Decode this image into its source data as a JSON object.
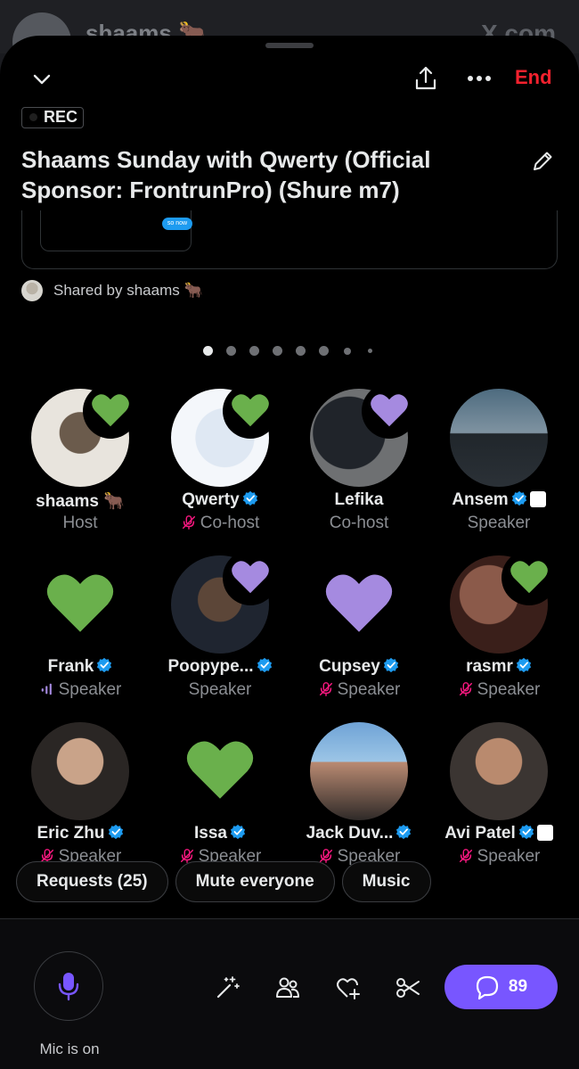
{
  "background": {
    "host_name": "shaams 🐂",
    "domain": "X.com"
  },
  "header": {
    "end_label": "End",
    "rec_label": "REC"
  },
  "space": {
    "title": "Shaams Sunday with Qwerty (Official Sponsor: FrontrunPro) (Shure m7)",
    "card_pill_text": "so now",
    "shared_by": "Shared by shaams 🐂"
  },
  "pager": {
    "total": 8,
    "active": 0
  },
  "colors": {
    "end": "#f4212e",
    "verified": "#1d9bf0",
    "heart_green": "#6ab04c",
    "heart_purple": "#a58ae0",
    "reply": "#7856ff",
    "mic": "#7856ff"
  },
  "participants": [
    {
      "name": "shaams 🐂",
      "role": "Host",
      "verified": false,
      "muted": false,
      "heart": "green"
    },
    {
      "name": "Qwerty",
      "role": "Co-host",
      "verified": true,
      "muted": true,
      "heart": "green"
    },
    {
      "name": "Lefika",
      "role": "Co-host",
      "verified": false,
      "muted": false,
      "heart": "purple"
    },
    {
      "name": "Ansem",
      "role": "Speaker",
      "verified": true,
      "muted": false,
      "heart": "none"
    },
    {
      "name": "Frank",
      "role": "Speaker",
      "verified": true,
      "muted": false,
      "speaking": true,
      "heart": "green"
    },
    {
      "name": "Poopype...",
      "role": "Speaker",
      "verified": true,
      "muted": false,
      "heart": "purple"
    },
    {
      "name": "Cupsey",
      "role": "Speaker",
      "verified": true,
      "muted": true,
      "heart": "purple"
    },
    {
      "name": "rasmr",
      "role": "Speaker",
      "verified": true,
      "muted": true,
      "heart": "green"
    },
    {
      "name": "Eric Zhu",
      "role": "Speaker",
      "verified": true,
      "muted": true,
      "heart": "none"
    },
    {
      "name": "Issa",
      "role": "Speaker",
      "verified": true,
      "muted": true,
      "heart": "green"
    },
    {
      "name": "Jack Duv...",
      "role": "Speaker",
      "verified": true,
      "muted": true,
      "heart": "none"
    },
    {
      "name": "Avi Patel",
      "role": "Speaker",
      "verified": true,
      "muted": true,
      "heart": "none"
    }
  ],
  "actions": {
    "requests": "Requests (25)",
    "mute_everyone": "Mute everyone",
    "music": "Music"
  },
  "bottom": {
    "mic_label": "Mic is on",
    "reply_count": "89"
  }
}
